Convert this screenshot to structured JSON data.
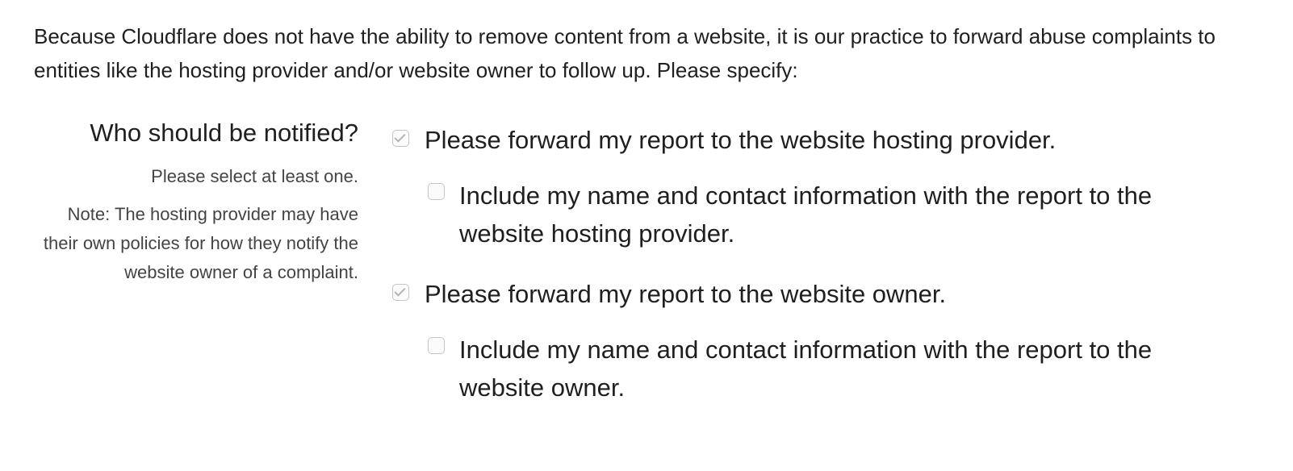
{
  "intro_text": "Because Cloudflare does not have the ability to remove content from a website, it is our practice to forward abuse complaints to entities like the hosting provider and/or website owner to follow up. Please specify:",
  "notify_section": {
    "heading": "Who should be notified?",
    "hint": "Please select at least one.",
    "note": "Note: The hosting provider may have their own policies for how they notify the website owner of a complaint."
  },
  "options": [
    {
      "label": "Please forward my report to the website hosting provider.",
      "checked": true,
      "disabled": true
    },
    {
      "label": "Include my name and contact information with the report to the website hosting provider.",
      "checked": false
    },
    {
      "label": "Please forward my report to the website owner.",
      "checked": true,
      "disabled": true
    },
    {
      "label": "Include my name and contact information with the report to the website owner.",
      "checked": false
    }
  ]
}
